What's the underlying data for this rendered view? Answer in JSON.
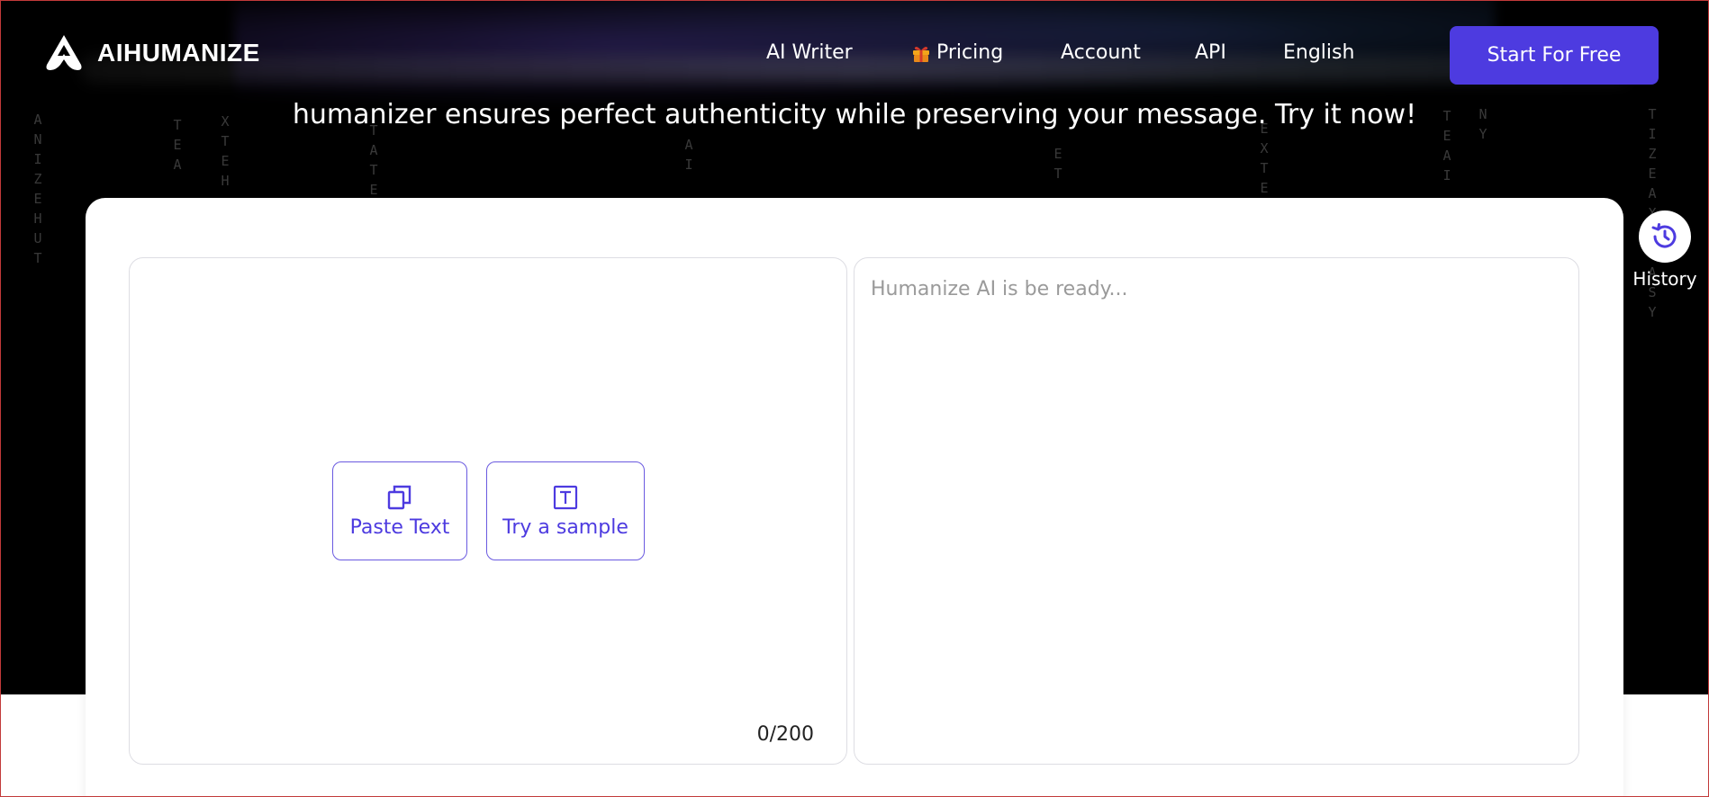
{
  "brand": {
    "name": "AIHUMANIZE",
    "accent": "#4d3be0",
    "background": "#000000"
  },
  "nav": {
    "items": [
      {
        "label": "AI Writer"
      },
      {
        "label": "Pricing",
        "icon": "gift-icon"
      },
      {
        "label": "Account"
      },
      {
        "label": "API"
      },
      {
        "label": "English"
      }
    ],
    "cta_label": "Start For Free"
  },
  "hero": {
    "subtitle": "humanizer ensures perfect authenticity while preserving your message. Try it now!"
  },
  "history": {
    "label": "History",
    "icon": "history-icon"
  },
  "editor": {
    "paste_label": "Paste Text",
    "paste_icon": "copy-icon",
    "sample_label": "Try a sample",
    "sample_icon": "text-box-icon",
    "char_count": "0/200"
  },
  "output": {
    "placeholder": "Humanize AI is be ready..."
  }
}
